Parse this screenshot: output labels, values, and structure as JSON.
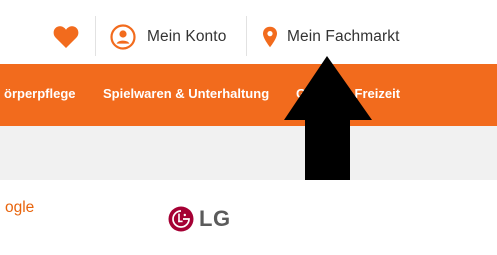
{
  "header": {
    "account_label": "Mein Konto",
    "store_label": "Mein Fachmarkt"
  },
  "nav": {
    "items": [
      {
        "label": "örperpflege"
      },
      {
        "label": "Spielwaren & Unterhaltung"
      },
      {
        "label": "Garten & Freizeit"
      }
    ]
  },
  "content": {
    "google_label": "ogle",
    "lg_label": "LG"
  },
  "colors": {
    "brand_orange": "#f26b1d",
    "text_dark": "#333333",
    "gray_bar": "#f1f1f1"
  },
  "icons": [
    "heart-icon",
    "user-circle-icon",
    "location-pin-icon",
    "lg-logo-icon",
    "arrow-up-icon"
  ]
}
